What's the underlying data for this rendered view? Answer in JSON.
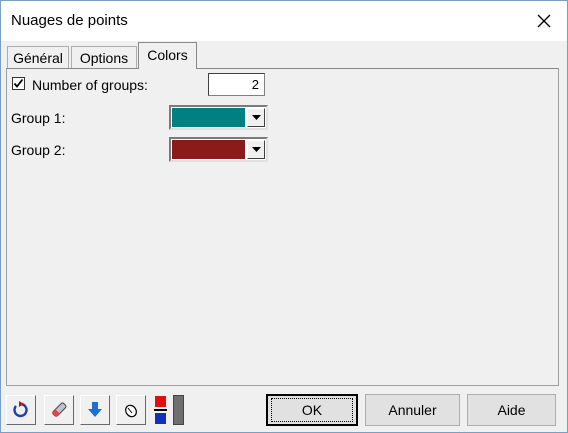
{
  "window": {
    "title": "Nuages de points"
  },
  "tabs": [
    {
      "label": "Général"
    },
    {
      "label": "Options"
    },
    {
      "label": "Colors"
    }
  ],
  "colors_tab": {
    "groups_checkbox_label": "Number of groups:",
    "groups_checked": true,
    "groups_value": "2",
    "groups": [
      {
        "label": "Group 1:",
        "color": "#008080"
      },
      {
        "label": "Group 2:",
        "color": "#8b1a1a"
      }
    ]
  },
  "toolbar_icons": [
    "reset-icon",
    "eraser-icon",
    "download-arrow-icon",
    "mouse-icon",
    "color-swatches-icon",
    "gray-bar-icon"
  ],
  "buttons": {
    "ok": "OK",
    "cancel": "Annuler",
    "help": "Aide"
  }
}
